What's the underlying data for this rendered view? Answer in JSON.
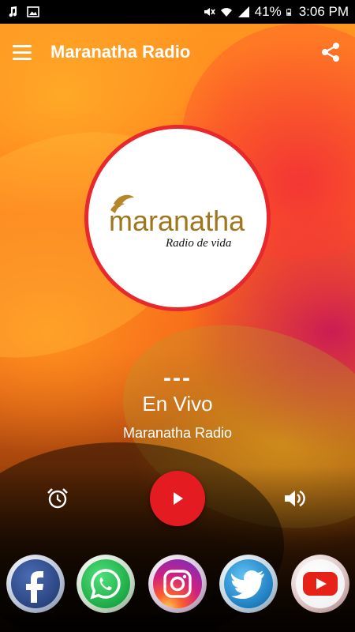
{
  "status_bar": {
    "battery": "41%",
    "time": "3:06 PM"
  },
  "app_bar": {
    "title": "Maranatha Radio"
  },
  "logo": {
    "brand": "maranatha",
    "tagline": "Radio de vida"
  },
  "player": {
    "track_title": "---",
    "live_label": "En Vivo",
    "station_name": "Maranatha Radio"
  },
  "colors": {
    "play_button": "#e41c22",
    "logo_ring": "#e8282d",
    "facebook": "#3b5998",
    "whatsapp": "#25d366",
    "instagram": "#c13584",
    "twitter": "#1da1f2",
    "youtube": "#ff0000"
  },
  "social": [
    "facebook-icon",
    "whatsapp-icon",
    "instagram-icon",
    "twitter-icon",
    "youtube-icon"
  ]
}
